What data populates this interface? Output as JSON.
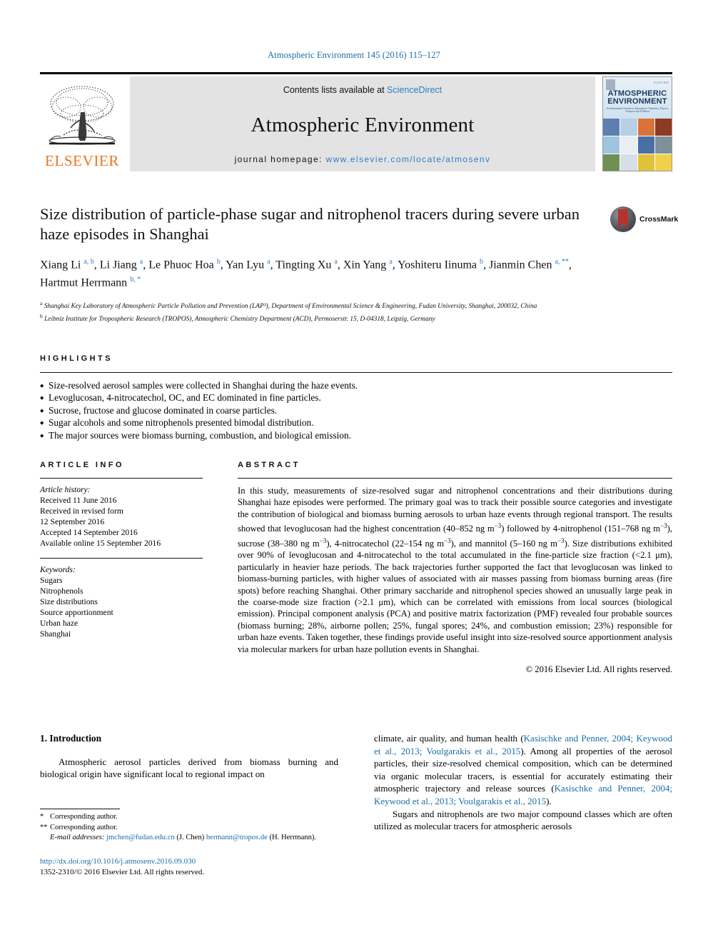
{
  "running_head": "Atmospheric Environment 145 (2016) 115–127",
  "masthead": {
    "publisher_name": "ELSEVIER",
    "contents_prefix": "Contents lists available at ",
    "contents_link": "ScienceDirect",
    "journal_title": "Atmospheric Environment",
    "homepage_label": "journal homepage: ",
    "homepage_url": "www.elsevier.com/locate/atmosenv",
    "cover": {
      "title_line1": "ATMOSPHERIC",
      "title_line2": "ENVIRONMENT",
      "subtitle": "An International Journal of Atmospheric Chemistry, Physics, Transport and Pollution",
      "publisher_mark": "ELSEVIER"
    }
  },
  "article": {
    "title": "Size distribution of particle-phase sugar and nitrophenol tracers during severe urban haze episodes in Shanghai",
    "crossmark_label": "CrossMark",
    "authors_html": "Xiang Li <sup>a, b</sup>, Li Jiang <sup>a</sup>, Le Phuoc Hoa <sup>b</sup>, Yan Lyu <sup>a</sup>, Tingting Xu <sup>a</sup>, Xin Yang <sup>a</sup>, Yoshiteru Iinuma <sup>b</sup>, Jianmin Chen <sup>a, **</sup>, Hartmut Herrmann <sup>b, *</sup>",
    "affiliation_a": "Shanghai Key Laboratory of Atmospheric Particle Pollution and Prevention (LAP³), Department of Environmental Science & Engineering, Fudan University, Shanghai, 200032, China",
    "affiliation_b": "Leibniz Institute for Tropospheric Research (TROPOS), Atmospheric Chemistry Department (ACD), Permoserstr. 15, D-04318, Leipzig, Germany"
  },
  "highlights": {
    "heading": "HIGHLIGHTS",
    "items": [
      "Size-resolved aerosol samples were collected in Shanghai during the haze events.",
      "Levoglucosan, 4-nitrocatechol, OC, and EC dominated in fine particles.",
      "Sucrose, fructose and glucose dominated in coarse particles.",
      "Sugar alcohols and some nitrophenols presented bimodal distribution.",
      "The major sources were biomass burning, combustion, and biological emission."
    ]
  },
  "article_info": {
    "heading": "ARTICLE INFO",
    "history_label": "Article history:",
    "history": [
      "Received 11 June 2016",
      "Received in revised form",
      "12 September 2016",
      "Accepted 14 September 2016",
      "Available online 15 September 2016"
    ],
    "keywords_label": "Keywords:",
    "keywords": [
      "Sugars",
      "Nitrophenols",
      "Size distributions",
      "Source apportionment",
      "Urban haze",
      "Shanghai"
    ]
  },
  "abstract": {
    "heading": "ABSTRACT",
    "text_html": "In this study, measurements of size-resolved sugar and nitrophenol concentrations and their distributions during Shanghai haze episodes were performed. The primary goal was to track their possible source categories and investigate the contribution of biological and biomass burning aerosols to urban haze events through regional transport. The results showed that levoglucosan had the highest concentration (40&ndash;852 ng m<sup>&minus;3</sup>) followed by 4-nitrophenol (151&ndash;768 ng m<sup>&minus;3</sup>), sucrose (38&ndash;380 ng m<sup>&minus;3</sup>), 4-nitrocatechol (22&ndash;154 ng m<sup>&minus;3</sup>), and mannitol (5&ndash;160 ng m<sup>&minus;3</sup>). Size distributions exhibited over 90% of levoglucosan and 4-nitrocatechol to the total accumulated in the fine-particle size fraction (&lt;2.1 &mu;m), particularly in heavier haze periods. The back trajectories further supported the fact that levoglucosan was linked to biomass-burning particles, with higher values of associated with air masses passing from biomass burning areas (fire spots) before reaching Shanghai. Other primary saccharide and nitrophenol species showed an unusually large peak in the coarse-mode size fraction (&gt;2.1 &mu;m), which can be correlated with emissions from local sources (biological emission). Principal component analysis (PCA) and positive matrix factorization (PMF) revealed four probable sources (biomass burning; 28%, airborne pollen; 25%, fungal spores; 24%, and combustion emission; 23%) responsible for urban haze events. Taken together, these findings provide useful insight into size-resolved source apportionment analysis via molecular markers for urban haze pollution events in Shanghai.",
    "copyright": "© 2016 Elsevier Ltd. All rights reserved."
  },
  "introduction": {
    "section_title": "1. Introduction",
    "left_paragraph": "Atmospheric aerosol particles derived from biomass burning and biological origin have significant local to regional impact on",
    "right_paragraph_html": "climate, air quality, and human health (<a class=\"cite\" href=\"#\" data-name=\"citation-link\" data-interactable=\"true\">Kasischke and Penner, 2004; Keywood et al., 2013; Voulgarakis et al., 2015</a>). Among all properties of the aerosol particles, their size-resolved chemical composition, which can be determined via organic molecular tracers, is essential for accurately estimating their atmospheric trajectory and release sources (<a class=\"cite\" href=\"#\" data-name=\"citation-link\" data-interactable=\"true\">Kasischke and Penner, 2004; Keywood et al., 2013; Voulgarakis et al., 2015</a>).",
    "right_paragraph2": "Sugars and nitrophenols are two major compound classes which are often utilized as molecular tracers for atmospheric aerosols"
  },
  "footnotes": {
    "corresponding_single": "Corresponding author.",
    "corresponding_double": "Corresponding author.",
    "email_label": "E-mail addresses:",
    "email1": "jmchen@fudan.edu.cn",
    "email1_owner": "(J. Chen)",
    "email2": "hermann@tropos.de",
    "email2_owner": "(H. Herrmann)."
  },
  "doi": {
    "url": "http://dx.doi.org/10.1016/j.atmosenv.2016.09.030",
    "issn_line": "1352-2310/© 2016 Elsevier Ltd. All rights reserved."
  },
  "colors": {
    "link_blue": "#1a6ca8",
    "elsevier_orange": "#E87722",
    "banner_gray": "#e3e3e3"
  }
}
